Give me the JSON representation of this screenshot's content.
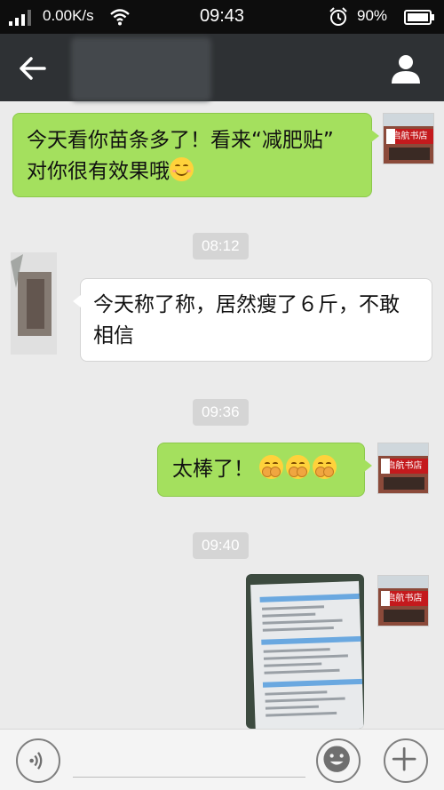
{
  "status_bar": {
    "network_speed": "0.00K/s",
    "time": "09:43",
    "battery_percent": "90%"
  },
  "header": {
    "back_icon": "arrow-left-icon",
    "profile_icon": "person-icon"
  },
  "messages": [
    {
      "sender": "me",
      "text_line1": "今天看你苗条多了！看来“减肥贴”",
      "text_line2": "对你很有效果哦",
      "trailing_emoji": "smile-emoji"
    },
    {
      "type": "time",
      "text": "08:12"
    },
    {
      "sender": "friend",
      "text_line1": "今天称了称，居然瘦了６斤，不敢",
      "text_line2": "相信"
    },
    {
      "type": "time",
      "text": "09:36"
    },
    {
      "sender": "me",
      "text": "太棒了！",
      "trailing_emojis": [
        "clap-emoji",
        "clap-emoji",
        "clap-emoji"
      ]
    },
    {
      "type": "time",
      "text": "09:40"
    },
    {
      "sender": "me",
      "type": "image"
    }
  ],
  "avatar": {
    "shop_sign": "启航书店"
  },
  "input_bar": {
    "voice_icon": "voice-icon",
    "emoji_icon": "emoji-icon",
    "plus_icon": "plus-icon"
  },
  "colors": {
    "my_bubble": "#a4e05e",
    "their_bubble": "#ffffff",
    "header_bg": "#2e3134",
    "status_bg": "#0d0d0d",
    "chat_bg": "#ebebeb"
  }
}
